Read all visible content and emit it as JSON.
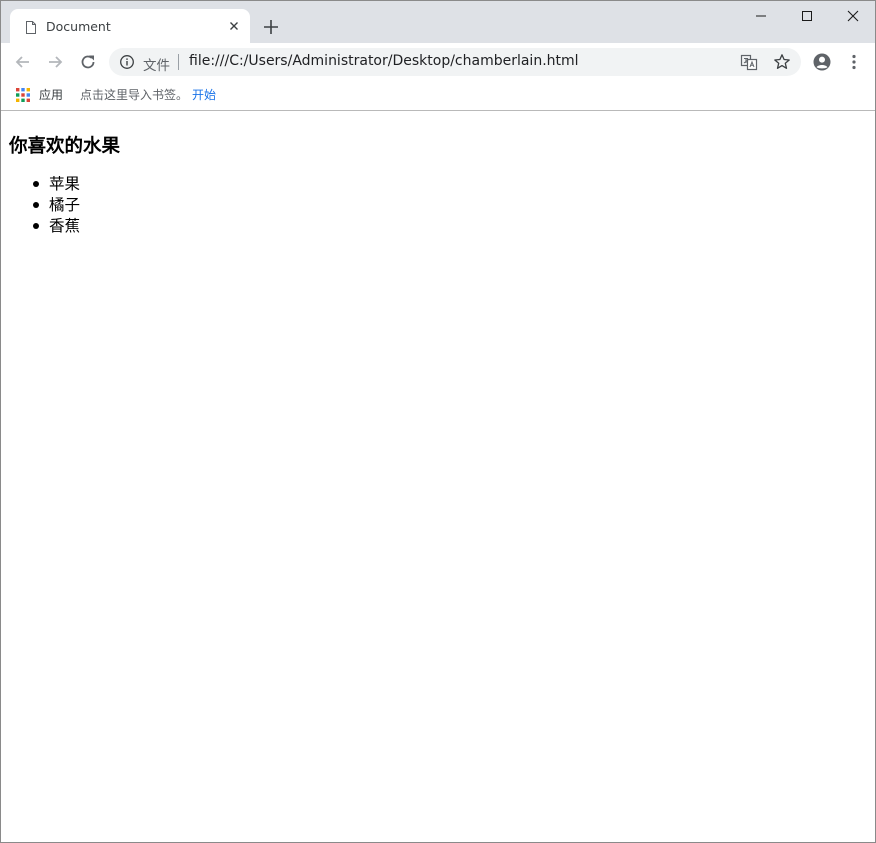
{
  "tab": {
    "title": "Document",
    "page_icon": "page-icon",
    "close_icon": "close-icon"
  },
  "new_tab_icon": "plus-icon",
  "window_controls": [
    "minimize-icon",
    "maximize-icon",
    "close-icon"
  ],
  "toolbar": {
    "back_icon": "arrow-left-icon",
    "forward_icon": "arrow-right-icon",
    "reload_icon": "reload-icon",
    "menu_icon": "kebab-menu-icon",
    "profile_icon": "account-circle-icon"
  },
  "omnibox": {
    "info_icon": "info-icon",
    "scheme_label": "文件",
    "url": "file:///C:/Users/Administrator/Desktop/chamberlain.html",
    "translate_icon": "translate-icon",
    "star_icon": "star-icon"
  },
  "bookmarks": {
    "apps_icon": "apps-grid-icon",
    "apps_label": "应用",
    "import_prompt": "点击这里导入书签。",
    "start_link": "开始"
  },
  "page": {
    "heading": "你喜欢的水果",
    "fruits": [
      "苹果",
      "橘子",
      "香蕉"
    ]
  },
  "colors": {
    "tabstrip_bg": "#dee1e6",
    "omnibox_bg": "#f1f3f4",
    "link_blue": "#1a73e8",
    "icon_gray": "#5f6368"
  }
}
